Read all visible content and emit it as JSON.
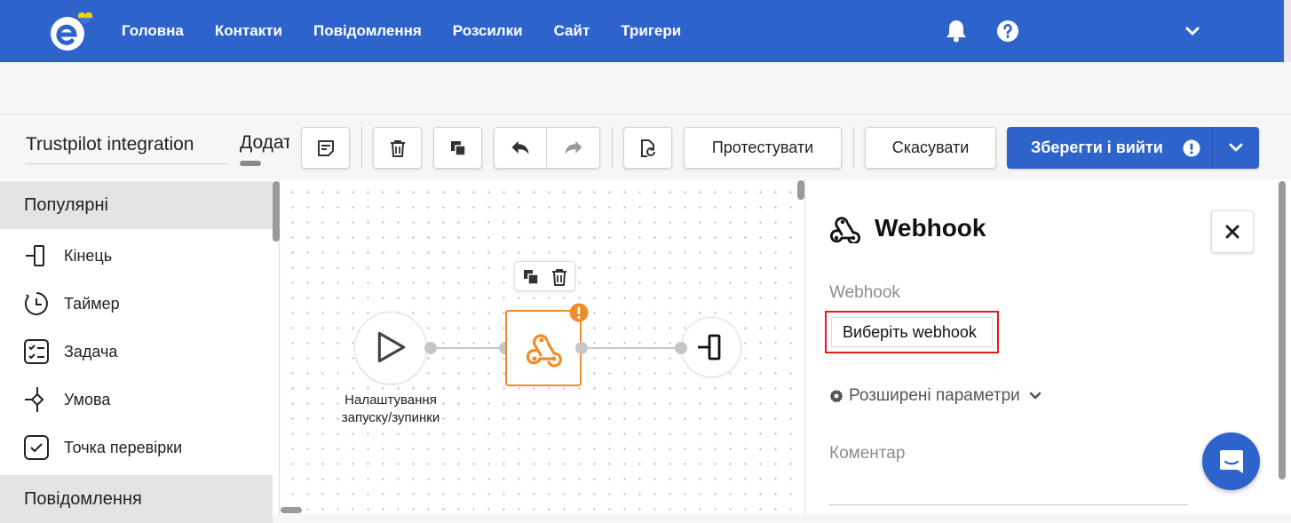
{
  "app": {
    "logo_icon": "sendpulse-e-logo-with-heart-icon",
    "accent_color": "#2e63cc",
    "warning_color": "#f08c28",
    "highlight_color": "#e51b1b"
  },
  "nav": {
    "items": [
      {
        "label": "Головна"
      },
      {
        "label": "Контакти"
      },
      {
        "label": "Повідомлення"
      },
      {
        "label": "Розсилки"
      },
      {
        "label": "Сайт"
      },
      {
        "label": "Тригери"
      }
    ],
    "icons": [
      "bell-icon",
      "help-icon",
      "chevron-down-icon"
    ]
  },
  "toolbar": {
    "flow_name": "Trustpilot integration",
    "add_tab_label": "Додати",
    "note_icon": "note-icon",
    "delete_icon": "trash-icon",
    "copy_icon": "copy-icon",
    "undo_icon": "undo-icon",
    "redo_icon": "redo-icon",
    "restore_icon": "file-restore-icon",
    "test_label": "Протестувати",
    "cancel_label": "Скасувати",
    "save_label": "Зберегти і вийти"
  },
  "palette": {
    "groups": [
      {
        "title": "Популярні"
      },
      {
        "title": "Повідомлення"
      }
    ],
    "items": [
      {
        "label": "Кінець",
        "icon": "end-icon"
      },
      {
        "label": "Таймер",
        "icon": "timer-icon"
      },
      {
        "label": "Задача",
        "icon": "task-icon"
      },
      {
        "label": "Умова",
        "icon": "condition-icon"
      },
      {
        "label": "Точка перевірки",
        "icon": "checkpoint-icon"
      }
    ]
  },
  "canvas": {
    "start_node_label": "Налаштування запуску/зупинки",
    "start_icon": "play-icon",
    "webhook_icon": "webhook-icon",
    "end_icon": "end-icon",
    "node_tools": [
      "copy-icon",
      "trash-icon"
    ]
  },
  "panel": {
    "title": "Webhook",
    "webhook_label": "Webhook",
    "select_placeholder": "Виберіть webhook",
    "advanced_label": "Розширені параметри",
    "comment_label": "Коментар"
  }
}
